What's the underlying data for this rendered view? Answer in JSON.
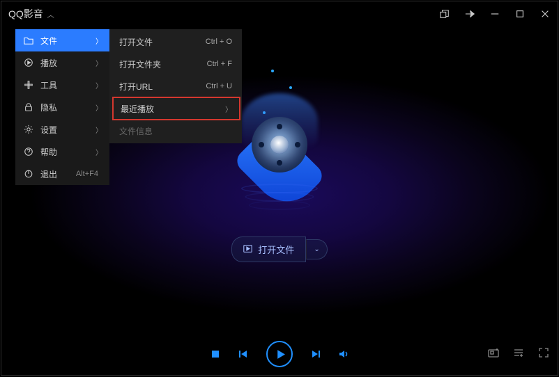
{
  "app": {
    "title": "QQ影音"
  },
  "menu": {
    "items": [
      {
        "label": "文件",
        "icon": "folder"
      },
      {
        "label": "播放",
        "icon": "play"
      },
      {
        "label": "工具",
        "icon": "tools"
      },
      {
        "label": "隐私",
        "icon": "privacy"
      },
      {
        "label": "设置",
        "icon": "settings"
      },
      {
        "label": "帮助",
        "icon": "help"
      }
    ],
    "exit": {
      "label": "退出",
      "shortcut": "Alt+F4"
    }
  },
  "submenu": {
    "items": [
      {
        "label": "打开文件",
        "shortcut": "Ctrl + O"
      },
      {
        "label": "打开文件夹",
        "shortcut": "Ctrl + F"
      },
      {
        "label": "打开URL",
        "shortcut": "Ctrl + U"
      },
      {
        "label": "最近播放",
        "has_arrow": true
      },
      {
        "label": "文件信息",
        "disabled": true
      }
    ]
  },
  "center": {
    "open_label": "打开文件"
  }
}
